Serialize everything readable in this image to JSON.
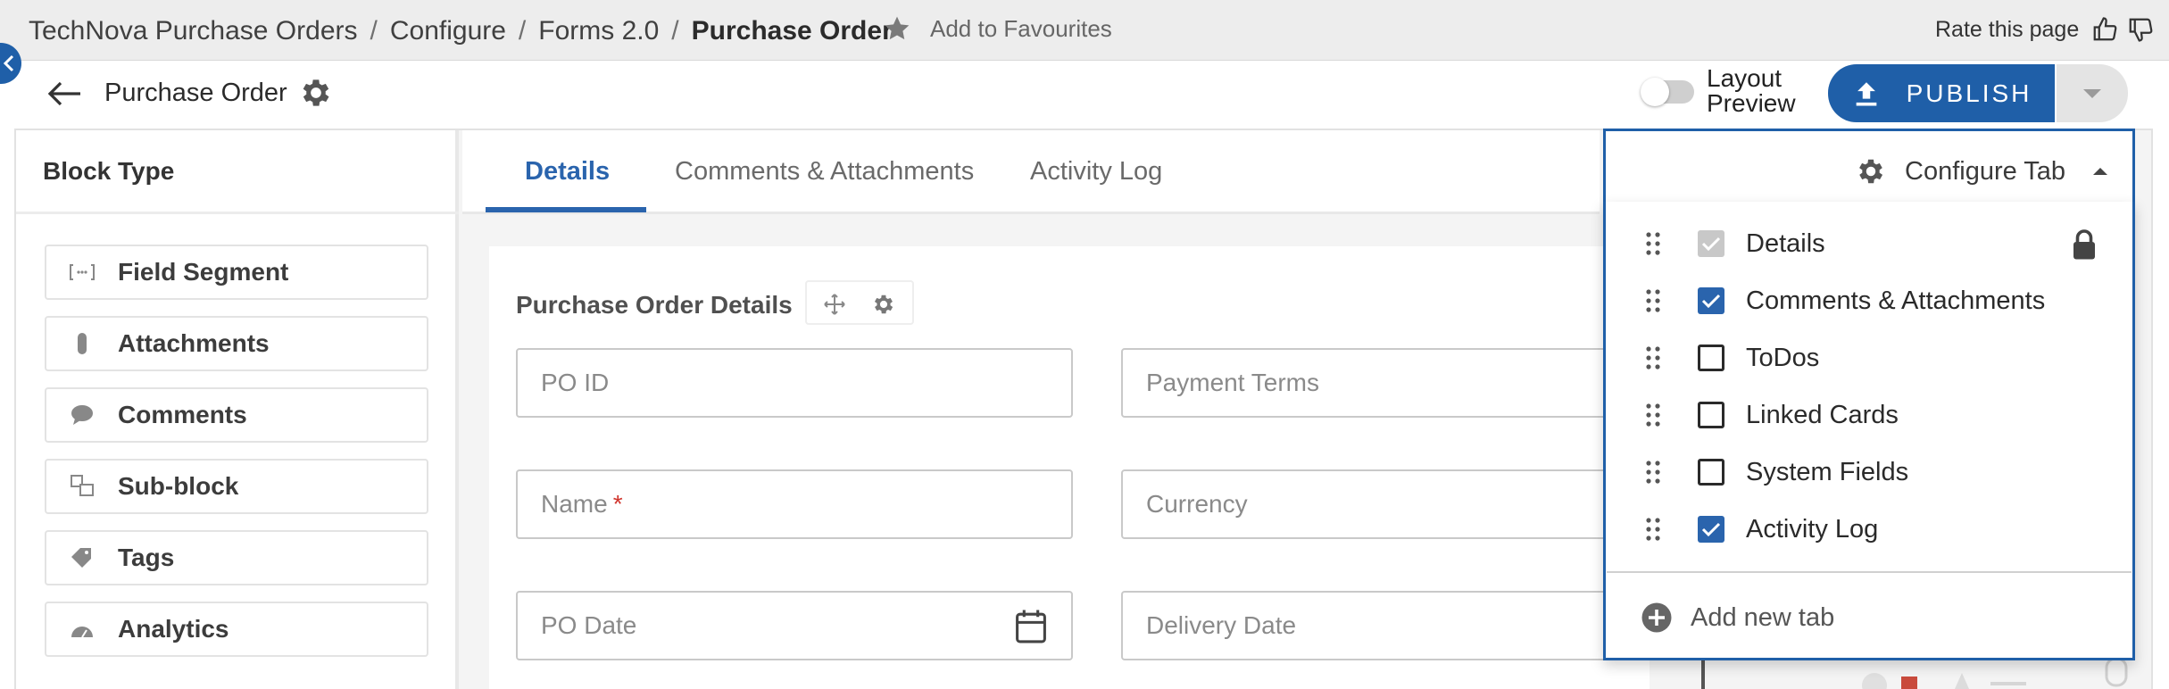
{
  "breadcrumb": {
    "items": [
      "TechNova Purchase Orders",
      "Configure",
      "Forms 2.0"
    ],
    "current": "Purchase Order",
    "separator": "/"
  },
  "favourites": {
    "label": "Add to Favourites",
    "icon": "star-icon"
  },
  "rate": {
    "label": "Rate this page",
    "icons": [
      "thumbs-up-icon",
      "thumbs-down-icon"
    ]
  },
  "header": {
    "title": "Purchase Order",
    "layout_preview_label": "Layout Preview",
    "layout_preview_on": false,
    "publish_label": "PUBLISH"
  },
  "block_panel": {
    "title": "Block Type",
    "items": [
      {
        "label": "Field Segment",
        "icon": "field-segment-icon"
      },
      {
        "label": "Attachments",
        "icon": "paperclip-icon"
      },
      {
        "label": "Comments",
        "icon": "comment-icon"
      },
      {
        "label": "Sub-block",
        "icon": "sub-block-icon"
      },
      {
        "label": "Tags",
        "icon": "tag-icon"
      },
      {
        "label": "Analytics",
        "icon": "gauge-icon"
      }
    ]
  },
  "tabs": {
    "items": [
      "Details",
      "Comments & Attachments",
      "Activity Log"
    ],
    "active": "Details"
  },
  "form": {
    "section_title": "Purchase Order Details",
    "fields": {
      "po_id": "PO ID",
      "payment_terms": "Payment Terms",
      "name": "Name",
      "required_mark": "*",
      "currency": "Currency",
      "po_date": "PO Date",
      "delivery_date": "Delivery Date"
    }
  },
  "configure_tab": {
    "label": "Configure Tab",
    "options": [
      {
        "label": "Details",
        "state": "checked-locked"
      },
      {
        "label": "Comments & Attachments",
        "state": "checked"
      },
      {
        "label": "ToDos",
        "state": "unchecked"
      },
      {
        "label": "Linked Cards",
        "state": "unchecked"
      },
      {
        "label": "System Fields",
        "state": "unchecked"
      },
      {
        "label": "Activity Log",
        "state": "checked"
      }
    ],
    "add_label": "Add new tab"
  },
  "colors": {
    "brand_blue": "#1f5fa8",
    "tab_active": "#2a64ad",
    "required": "#d0342c"
  }
}
